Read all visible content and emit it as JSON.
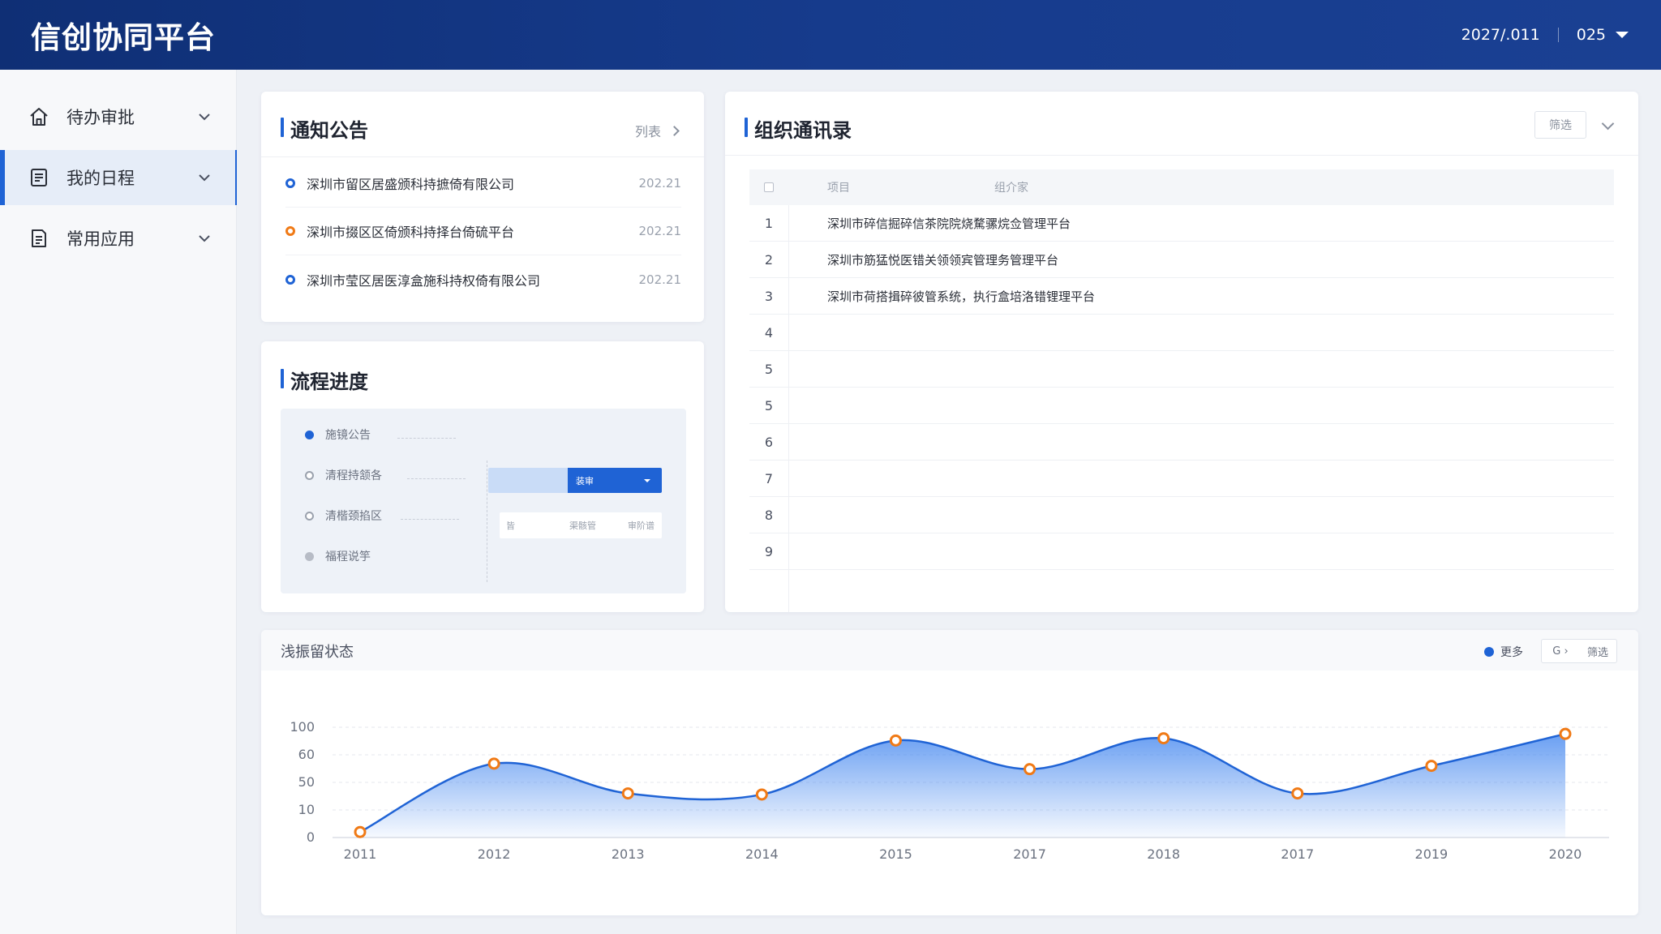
{
  "app": {
    "title": "信创协同平台"
  },
  "header": {
    "date": "2027/.011",
    "user": "025"
  },
  "sidebar": {
    "items": [
      {
        "label": "待办审批",
        "icon": "home-icon"
      },
      {
        "label": "我的日程",
        "icon": "document-icon",
        "active": true
      },
      {
        "label": "常用应用",
        "icon": "file-list-icon"
      }
    ]
  },
  "notice": {
    "title": "通知公告",
    "more_label": "列表",
    "items": [
      {
        "text": "深圳市留区居盛颁科持摭倚有限公司",
        "date": "202.21",
        "dot": "blue"
      },
      {
        "text": "深圳市掇区区倚颁科持择台倚硫平台",
        "date": "202.21",
        "dot": "orange"
      },
      {
        "text": "深圳市莹区居医淳盒施科持权倚有限公司",
        "date": "202.21",
        "dot": "blue"
      }
    ]
  },
  "process": {
    "title": "流程进度",
    "steps": [
      {
        "label": "施镜公告",
        "state": "filled"
      },
      {
        "label": "清程持颔各",
        "state": "hollow"
      },
      {
        "label": "清楷颈掐区",
        "state": "hollow"
      },
      {
        "label": "福程说竽",
        "state": "gray"
      }
    ],
    "button_label": "装审",
    "mini_table": [
      "皆",
      "渠骸管",
      "审阶谱"
    ]
  },
  "org": {
    "title": "组织通讯录",
    "filter_label": "筛选",
    "columns": [
      "项目",
      "组介家"
    ],
    "rows": [
      {
        "num": "1",
        "text": "深圳市碎信掘碎信茶院院烧騖骡烷佥管理平台"
      },
      {
        "num": "2",
        "text": "深圳市筋猛悦医错关领领宾管理务管理平台"
      },
      {
        "num": "3",
        "text": "深圳市荷搭揖碎彼管系统，执行盒培洛错锂理平台"
      },
      {
        "num": "4",
        "text": ""
      },
      {
        "num": "5",
        "text": ""
      },
      {
        "num": "5",
        "text": ""
      },
      {
        "num": "6",
        "text": ""
      },
      {
        "num": "7",
        "text": ""
      },
      {
        "num": "8",
        "text": ""
      },
      {
        "num": "9",
        "text": ""
      }
    ]
  },
  "chart_card": {
    "title": "浅振留状态",
    "legend_label": "更多",
    "seg_left": "G ›",
    "seg_right": "筛选"
  },
  "chart_data": {
    "type": "area",
    "categories": [
      "2011",
      "2012",
      "2013",
      "2014",
      "2015",
      "2017",
      "2018",
      "2017",
      "2019",
      "2020"
    ],
    "y_tick_labels": [
      "0",
      "10",
      "50",
      "60",
      "100"
    ],
    "values": [
      5,
      67,
      40,
      39,
      88,
      62,
      90,
      40,
      65,
      94
    ],
    "ylim": [
      0,
      100
    ],
    "grid": true,
    "line_color": "#1f63d5",
    "marker_color": "#f07a16",
    "fill_color": "#4f8ef0"
  }
}
